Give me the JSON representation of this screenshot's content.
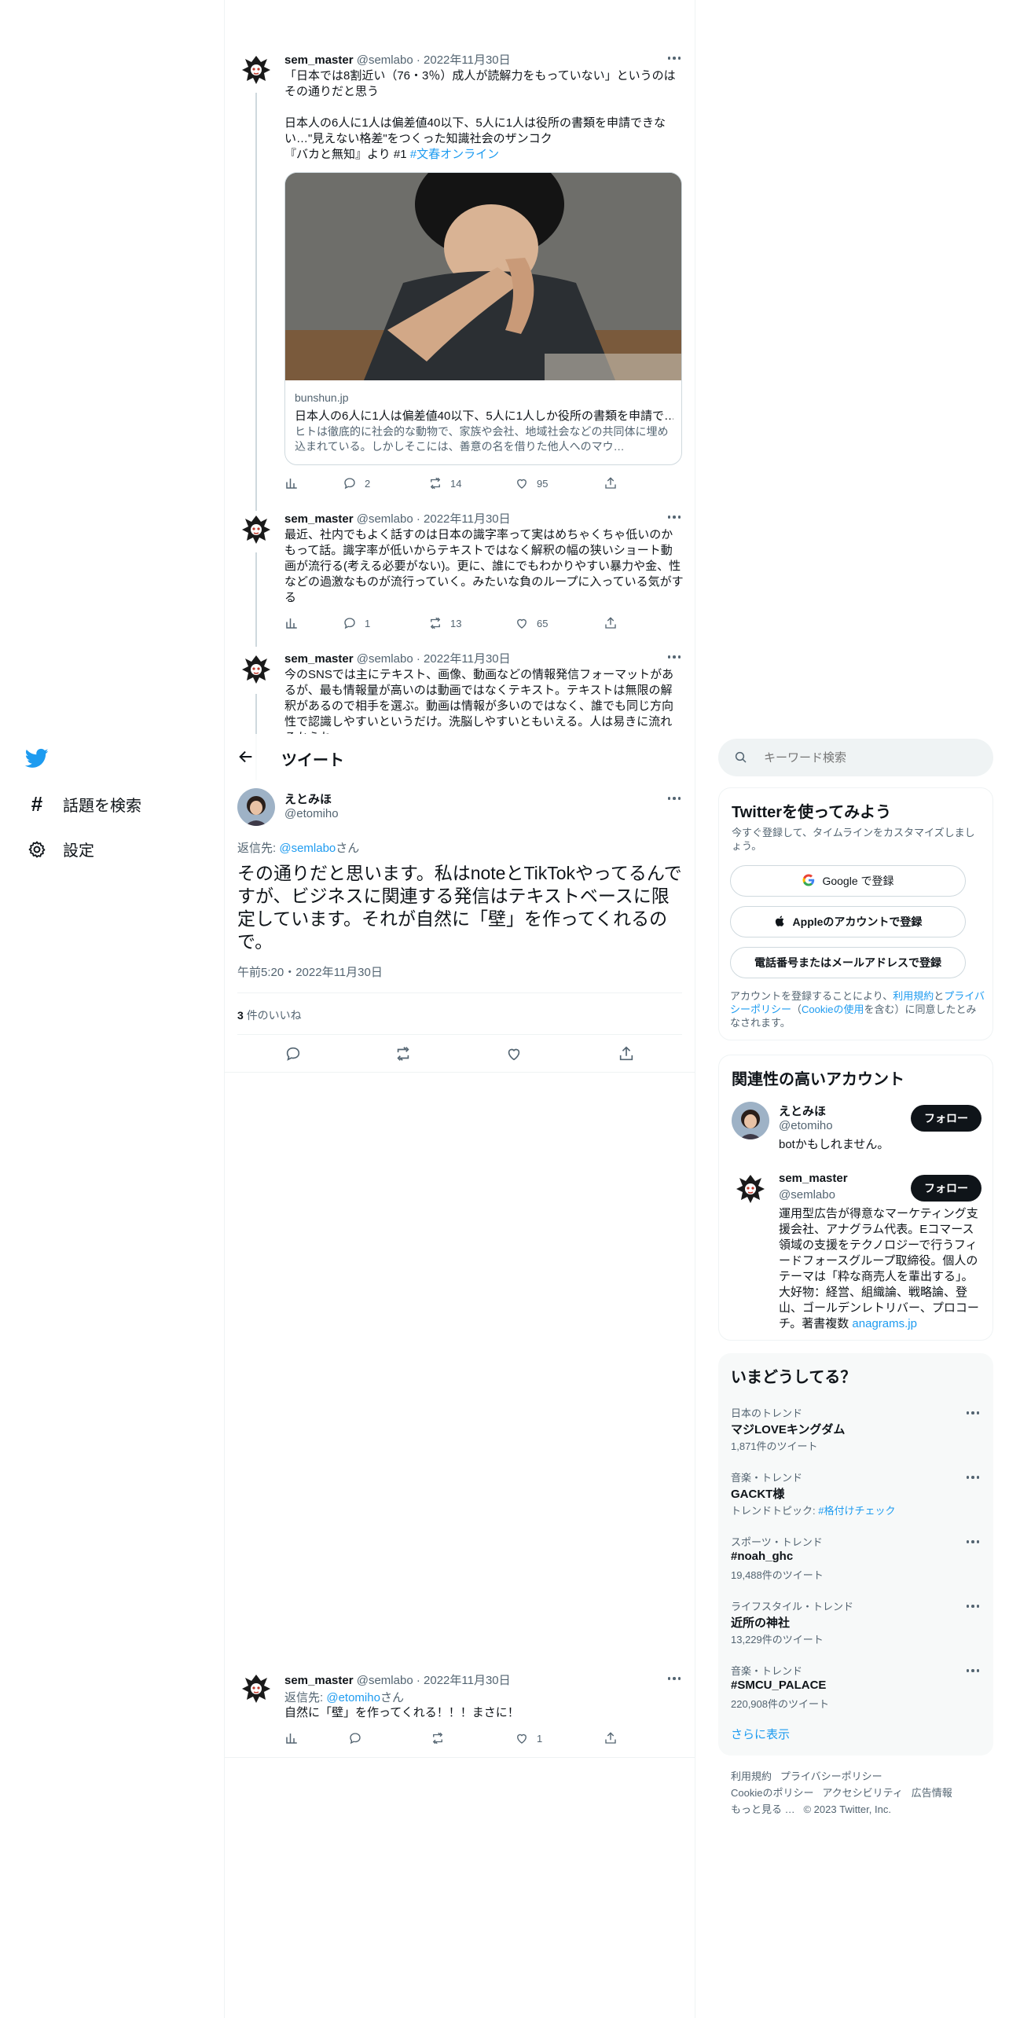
{
  "nav": {
    "explore_label": "話題を検索",
    "settings_label": "設定"
  },
  "header": {
    "title": "ツイート"
  },
  "search": {
    "placeholder": "キーワード検索"
  },
  "thread": [
    {
      "name": "sem_master",
      "handle": "@semlabo",
      "date": "2022年11月30日",
      "text": "「日本では8割近い（76・3％）成人が読解力をもっていない」というのはその通りだと思う\n\n日本人の6人に1人は偏差値40以下、5人に1人は役所の書類を申請できない…\"見えない格差\"をつくった知識社会のザンコク\n『バカと無知』より #1 ",
      "hashtag": "#文春オンライン",
      "card": {
        "domain": "bunshun.jp",
        "title": "日本人の6人に1人は偏差値40以下、5人に1人しか役所の書類を申請で…",
        "desc": "ヒトは徹底的に社会的な動物で、家族や会社、地域社会などの共同体に埋め込まれている。しかしそこには、善意の名を借りた他人へのマウ…"
      },
      "replies": "2",
      "retweets": "14",
      "likes": "95"
    },
    {
      "name": "sem_master",
      "handle": "@semlabo",
      "date": "2022年11月30日",
      "text": "最近、社内でもよく話すのは日本の識字率って実はめちゃくちゃ低いのかもって話。識字率が低いからテキストではなく解釈の幅の狭いショート動画が流行る(考える必要がない)。更に、誰にでもわかりやすい暴力や金、性などの過激なものが流行っていく。みたいな負のループに入っている気がする",
      "replies": "1",
      "retweets": "13",
      "likes": "65"
    },
    {
      "name": "sem_master",
      "handle": "@semlabo",
      "date": "2022年11月30日",
      "text": "今のSNSでは主にテキスト、画像、動画などの情報発信フォーマットがあるが、最も情報量が高いのは動画ではなくテキスト。テキストは無限の解釈があるので相手を選ぶ。動画は情報が多いのではなく、誰でも同じ方向性で認識しやすいというだけ。洗脳しやすいともいえる。人は易きに流れるからね"
    }
  ],
  "main_tweet": {
    "name": "えとみほ",
    "handle": "@etomiho",
    "reply_to_prefix": "返信先: ",
    "reply_to_handle": "@semlabo",
    "reply_to_suffix": "さん",
    "text": "その通りだと思います。私はnoteとTikTokやってるんですが、ビジネスに関連する発信はテキストベースに限定しています。それが自然に「壁」を作ってくれるので。",
    "timestamp": "午前5:20・2022年11月30日",
    "likes_count": "3",
    "likes_label": "件のいいね"
  },
  "reply_tweet": {
    "name": "sem_master",
    "handle": "@semlabo",
    "date": "2022年11月30日",
    "reply_to_prefix": "返信先: ",
    "reply_to_handle": "@etomiho",
    "reply_to_suffix": "さん",
    "text": "自然に「壁」を作ってくれる！！！まさに！",
    "likes": "1"
  },
  "signup": {
    "title": "Twitterを使ってみよう",
    "subtitle": "今すぐ登録して、タイムラインをカスタマイズしましょう。",
    "google_label": "Google で登録",
    "apple_label": "Appleのアカウントで登録",
    "phone_label": "電話番号またはメールアドレスで登録",
    "legal_1": "アカウントを登録することにより、",
    "legal_terms": "利用規約",
    "legal_and": "と",
    "legal_privacy": "プライバシーポリシー",
    "legal_paren_open": "（",
    "legal_cookie": "Cookieの使用",
    "legal_2": "を含む）に同意したとみなされます。"
  },
  "related": {
    "title": "関連性の高いアカウント",
    "follow_label": "フォロー",
    "accounts": [
      {
        "name": "えとみほ",
        "handle": "@etomiho",
        "bio": "botかもしれません。"
      },
      {
        "name": "sem_master",
        "handle": "@semlabo",
        "bio": "運用型広告が得意なマーケティング支援会社、アナグラム代表。Eコマース領域の支援をテクノロジーで行うフィードフォースグループ取締役。個人のテーマは「粋な商売人を輩出する」。大好物：経営、組織論、戦略論、登山、ゴールデンレトリバー、プロコーチ。著書複数 ",
        "bio_link": "anagrams.jp"
      }
    ]
  },
  "trends": {
    "title": "いまどうしてる？",
    "show_more": "さらに表示",
    "items": [
      {
        "category": "日本のトレンド",
        "name": "マジLOVEキングダム",
        "count": "1,871件のツイート"
      },
      {
        "category": "音楽・トレンド",
        "name": "GACKT様",
        "count_prefix": "トレンドトピック: ",
        "count_link": "#格付けチェック"
      },
      {
        "category": "スポーツ・トレンド",
        "name": "#noah_ghc",
        "count": "19,488件のツイート"
      },
      {
        "category": "ライフスタイル・トレンド",
        "name": "近所の神社",
        "count": "13,229件のツイート"
      },
      {
        "category": "音楽・トレンド",
        "name": "#SMCU_PALACE",
        "count": "220,908件のツイート"
      }
    ]
  },
  "footer": {
    "links": [
      "利用規約",
      "プライバシーポリシー",
      "Cookieのポリシー",
      "アクセシビリティ",
      "広告情報",
      "もっと見る …"
    ],
    "copyright": "© 2023 Twitter, Inc."
  },
  "colors": {
    "accent": "#1d9bf0",
    "text": "#0f1419",
    "muted": "#536471",
    "border": "#eff3f4"
  }
}
